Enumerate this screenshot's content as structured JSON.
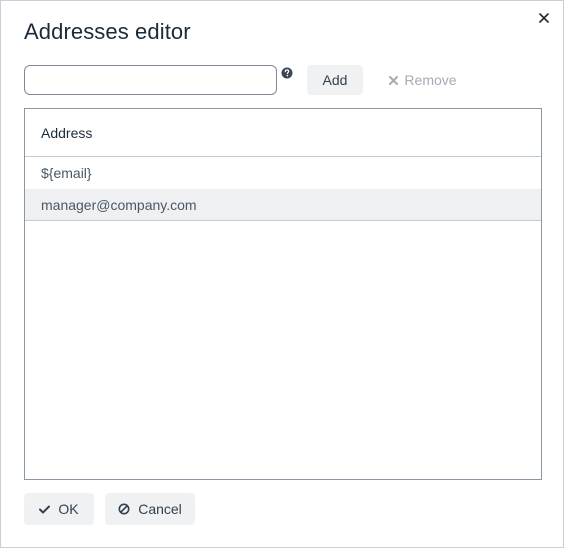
{
  "dialog": {
    "title": "Addresses editor",
    "close_icon": "close-icon"
  },
  "input": {
    "value": "",
    "placeholder": ""
  },
  "toolbar": {
    "help_icon": "question-circle-icon",
    "add_label": "Add",
    "remove_label": "Remove",
    "remove_icon": "x-icon"
  },
  "table": {
    "column_header": "Address",
    "rows": [
      {
        "address": "${email}",
        "selected": false
      },
      {
        "address": "manager@company.com",
        "selected": true
      }
    ]
  },
  "footer": {
    "ok_label": "OK",
    "ok_icon": "check-icon",
    "cancel_label": "Cancel",
    "cancel_icon": "ban-icon"
  },
  "colors": {
    "selected_row": "#eef0f2",
    "button_bg": "#f0f1f3",
    "disabled_text": "#a3acb6"
  }
}
